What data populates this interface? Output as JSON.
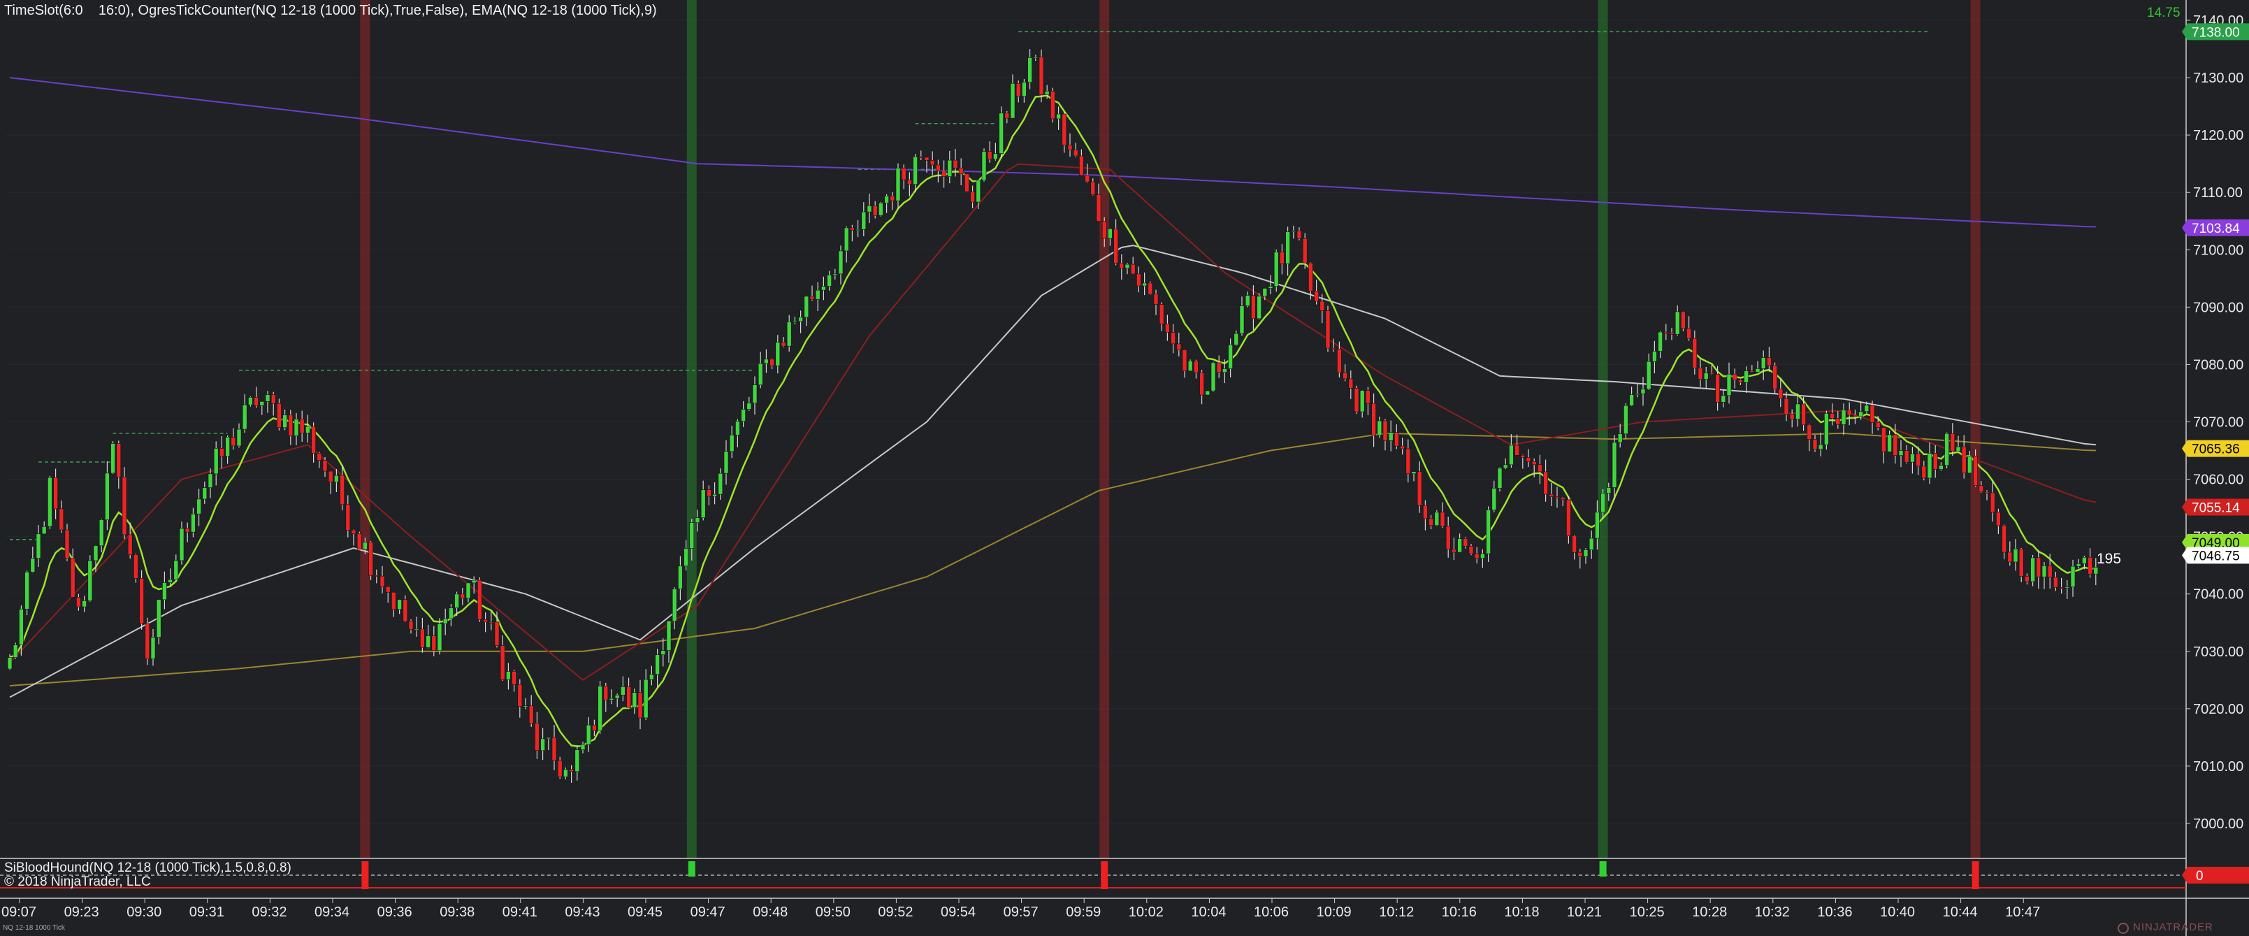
{
  "header": {
    "title": "TimeSlot(6:0    16:0), OgresTickCounter(NQ 12-18 (1000 Tick),True,False), EMA(NQ 12-18 (1000 Tick),9)",
    "tick_info": "14.75"
  },
  "indicator_panel": {
    "label": "SiBloodHound(NQ 12-18 (1000 Tick),1.5,0.8,0.8)",
    "copyright": "© 2018 NinjaTrader, LLC",
    "value_badge": "0"
  },
  "tick_counter": "195",
  "instrument_small": "NQ 12-18 1000 Tick",
  "brand": "NINJATRADER",
  "colors": {
    "background": "#1f2125",
    "up_candle": "#3fd63f",
    "down_candle": "#ee2424",
    "ema_fast": "#9ee52a",
    "ema_red": "#8a1f1f",
    "ema_white": "#c8c8c8",
    "ema_gold": "#9a8630",
    "ema_purple": "#6b3fc8"
  },
  "price_axis": {
    "ticks": [
      "7140.00",
      "7130.00",
      "7120.00",
      "7110.00",
      "7100.00",
      "7090.00",
      "7080.00",
      "7070.00",
      "7060.00",
      "7050.00",
      "7040.00",
      "7030.00",
      "7020.00",
      "7010.00",
      "7000.00"
    ],
    "badges": [
      {
        "label": "7138.00",
        "price": 7138.0,
        "bg": "#2aa04a",
        "fg": "#ffffff"
      },
      {
        "label": "7103.84",
        "price": 7103.84,
        "bg": "#8a3cdc",
        "fg": "#ffffff"
      },
      {
        "label": "7065.36",
        "price": 7065.36,
        "bg": "#f0d020",
        "fg": "#000000"
      },
      {
        "label": "7055.14",
        "price": 7055.14,
        "bg": "#d02020",
        "fg": "#ffffff"
      },
      {
        "label": "7049.00",
        "price": 7049.0,
        "bg": "#8ee32a",
        "fg": "#000000"
      },
      {
        "label": "7046.75",
        "price": 7046.75,
        "bg": "#ffffff",
        "fg": "#000000"
      }
    ]
  },
  "time_axis": {
    "labels": [
      "09:07",
      "09:23",
      "09:30",
      "09:31",
      "09:32",
      "09:34",
      "09:36",
      "09:38",
      "09:41",
      "09:43",
      "09:45",
      "09:47",
      "09:48",
      "09:50",
      "09:52",
      "09:54",
      "09:57",
      "09:59",
      "10:02",
      "10:04",
      "10:06",
      "10:09",
      "10:12",
      "10:16",
      "10:18",
      "10:21",
      "10:25",
      "10:28",
      "10:32",
      "10:36",
      "10:40",
      "10:44",
      "10:47"
    ]
  },
  "chart_data": {
    "type": "candlestick",
    "instrument": "NQ 12-18 (1000 Tick)",
    "ylim": [
      6996,
      7143
    ],
    "session_markers": [
      {
        "bar": 62,
        "color": "red"
      },
      {
        "bar": 119,
        "color": "green"
      },
      {
        "bar": 191,
        "color": "red"
      },
      {
        "bar": 278,
        "color": "green"
      },
      {
        "bar": 343,
        "color": "red"
      }
    ],
    "close_path_anchors": [
      {
        "bar": 0,
        "price": 7028
      },
      {
        "bar": 7,
        "price": 7058
      },
      {
        "bar": 12,
        "price": 7036
      },
      {
        "bar": 18,
        "price": 7064
      },
      {
        "bar": 24,
        "price": 7030
      },
      {
        "bar": 32,
        "price": 7056
      },
      {
        "bar": 43,
        "price": 7074
      },
      {
        "bar": 52,
        "price": 7068
      },
      {
        "bar": 62,
        "price": 7048
      },
      {
        "bar": 72,
        "price": 7030
      },
      {
        "bar": 80,
        "price": 7042
      },
      {
        "bar": 92,
        "price": 7014
      },
      {
        "bar": 98,
        "price": 7008
      },
      {
        "bar": 104,
        "price": 7024
      },
      {
        "bar": 110,
        "price": 7020
      },
      {
        "bar": 121,
        "price": 7056
      },
      {
        "bar": 133,
        "price": 7082
      },
      {
        "bar": 146,
        "price": 7101
      },
      {
        "bar": 160,
        "price": 7118
      },
      {
        "bar": 168,
        "price": 7110
      },
      {
        "bar": 178,
        "price": 7133
      },
      {
        "bar": 186,
        "price": 7115
      },
      {
        "bar": 192,
        "price": 7102
      },
      {
        "bar": 200,
        "price": 7090
      },
      {
        "bar": 208,
        "price": 7074
      },
      {
        "bar": 214,
        "price": 7086
      },
      {
        "bar": 224,
        "price": 7102
      },
      {
        "bar": 232,
        "price": 7078
      },
      {
        "bar": 240,
        "price": 7068
      },
      {
        "bar": 250,
        "price": 7050
      },
      {
        "bar": 256,
        "price": 7045
      },
      {
        "bar": 262,
        "price": 7068
      },
      {
        "bar": 268,
        "price": 7060
      },
      {
        "bar": 275,
        "price": 7046
      },
      {
        "bar": 282,
        "price": 7072
      },
      {
        "bar": 290,
        "price": 7088
      },
      {
        "bar": 298,
        "price": 7074
      },
      {
        "bar": 306,
        "price": 7080
      },
      {
        "bar": 314,
        "price": 7068
      },
      {
        "bar": 324,
        "price": 7070
      },
      {
        "bar": 332,
        "price": 7062
      },
      {
        "bar": 340,
        "price": 7066
      },
      {
        "bar": 348,
        "price": 7048
      },
      {
        "bar": 356,
        "price": 7042
      },
      {
        "bar": 363,
        "price": 7046
      }
    ],
    "ema_lines": {
      "purple": [
        [
          0,
          7130
        ],
        [
          60,
          7123
        ],
        [
          120,
          7115
        ],
        [
          190,
          7113
        ],
        [
          230,
          7111
        ],
        [
          300,
          7107
        ],
        [
          363,
          7104
        ]
      ],
      "gold": [
        [
          0,
          7024
        ],
        [
          40,
          7027
        ],
        [
          70,
          7030
        ],
        [
          100,
          7030
        ],
        [
          130,
          7034
        ],
        [
          160,
          7043
        ],
        [
          190,
          7058
        ],
        [
          220,
          7065
        ],
        [
          240,
          7068
        ],
        [
          280,
          7067
        ],
        [
          320,
          7068
        ],
        [
          363,
          7065
        ]
      ],
      "white": [
        [
          0,
          7022
        ],
        [
          30,
          7038
        ],
        [
          60,
          7048
        ],
        [
          90,
          7040
        ],
        [
          110,
          7032
        ],
        [
          130,
          7048
        ],
        [
          160,
          7070
        ],
        [
          180,
          7092
        ],
        [
          195,
          7101
        ],
        [
          215,
          7096
        ],
        [
          240,
          7088
        ],
        [
          260,
          7078
        ],
        [
          280,
          7077
        ],
        [
          320,
          7074
        ],
        [
          363,
          7066
        ]
      ],
      "red": [
        [
          0,
          7028
        ],
        [
          30,
          7060
        ],
        [
          52,
          7066
        ],
        [
          70,
          7050
        ],
        [
          100,
          7025
        ],
        [
          120,
          7038
        ],
        [
          150,
          7085
        ],
        [
          175,
          7115
        ],
        [
          192,
          7114
        ],
        [
          212,
          7096
        ],
        [
          240,
          7078
        ],
        [
          262,
          7066
        ],
        [
          285,
          7070
        ],
        [
          320,
          7072
        ],
        [
          363,
          7056
        ]
      ]
    },
    "dashed_levels": [
      {
        "price": 7138.0,
        "from_bar": 176,
        "to_bar": 335
      },
      {
        "price": 7079.0,
        "from_bar": 40,
        "to_bar": 130
      },
      {
        "price": 7068.0,
        "from_bar": 18,
        "to_bar": 38
      },
      {
        "price": 7063.0,
        "from_bar": 5,
        "to_bar": 18
      },
      {
        "price": 7049.5,
        "from_bar": 0,
        "to_bar": 5
      },
      {
        "price": 7114.0,
        "from_bar": 148,
        "to_bar": 162
      },
      {
        "price": 7122.0,
        "from_bar": 158,
        "to_bar": 172
      }
    ]
  }
}
